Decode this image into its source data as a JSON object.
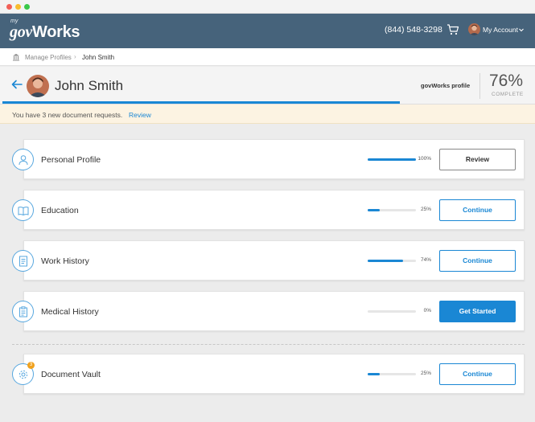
{
  "nav": {
    "logo_my": "my",
    "logo_gov": "gov",
    "logo_works": "Works",
    "phone": "(844) 548-3298",
    "account_label": "My Account"
  },
  "breadcrumb": {
    "parent": "Manage Profiles",
    "separator": "›",
    "current": "John Smith"
  },
  "profile": {
    "name": "John Smith",
    "profile_label": "govWorks profile",
    "percent": "76%",
    "percent_label": "COMPLETE",
    "progress_fraction": 0.76
  },
  "notice": {
    "text": "You have 3 new document requests.",
    "link": "Review"
  },
  "sections": [
    {
      "title": "Personal Profile",
      "percent": "100%",
      "progress": 1.0,
      "button": "Review",
      "icon": "person-icon"
    },
    {
      "title": "Education",
      "percent": "25%",
      "progress": 0.25,
      "button": "Continue",
      "icon": "book-icon"
    },
    {
      "title": "Work History",
      "percent": "74%",
      "progress": 0.74,
      "button": "Continue",
      "icon": "document-icon"
    },
    {
      "title": "Medical History",
      "percent": "0%",
      "progress": 0.0,
      "button": "Get Started",
      "icon": "clipboard-icon"
    },
    {
      "title": "Document Vault",
      "percent": "25%",
      "progress": 0.25,
      "button": "Continue",
      "icon": "gear-icon",
      "badge": "3"
    }
  ],
  "colors": {
    "navbar": "#46637b",
    "accent": "#1a87d4",
    "notice_bg": "#fcf3e2",
    "badge": "#f0a11d"
  }
}
